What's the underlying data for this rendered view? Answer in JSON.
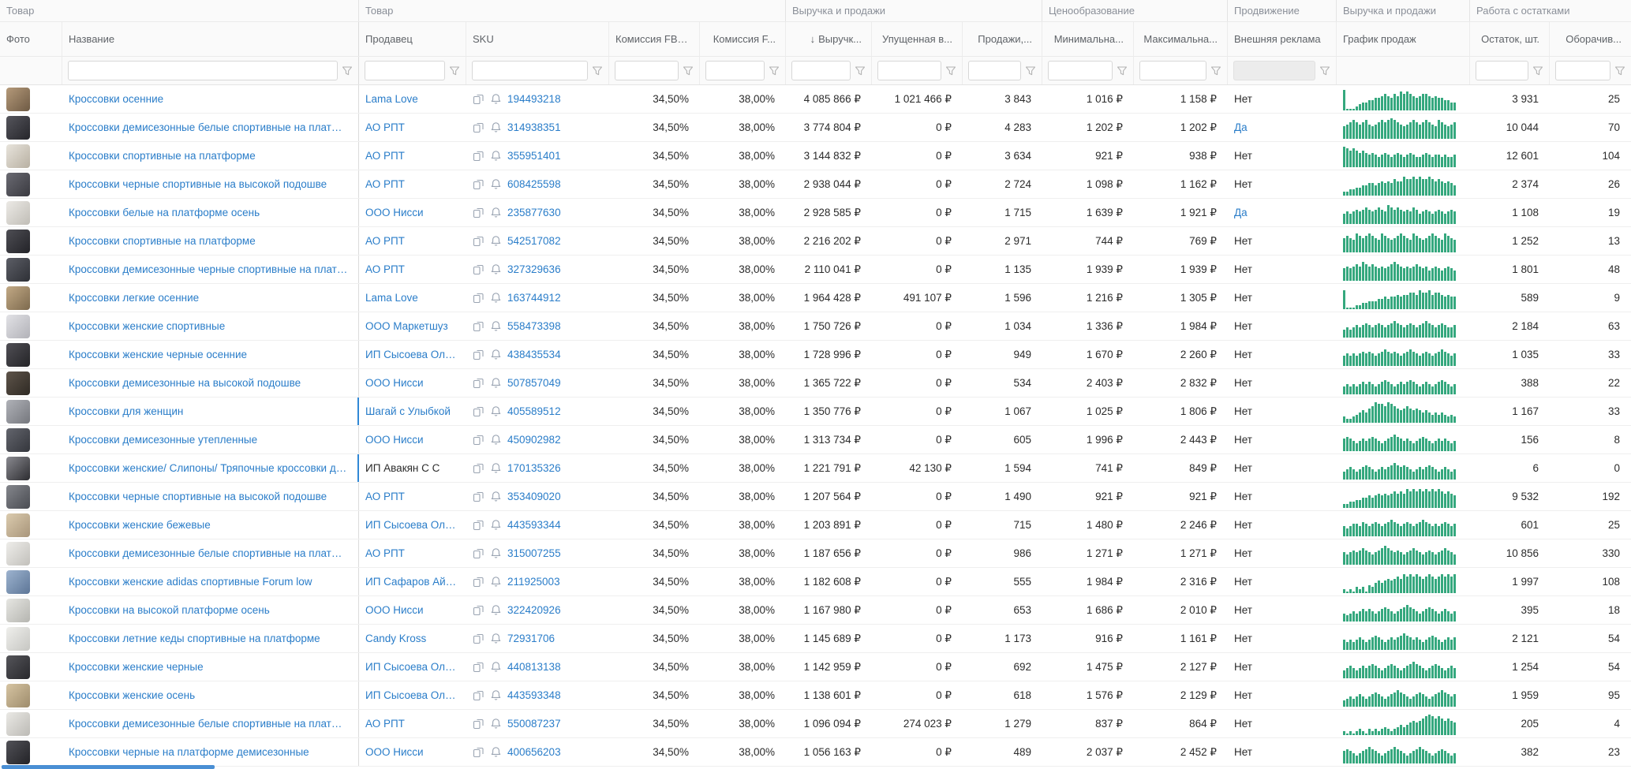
{
  "colors": {
    "link": "#2a7dc9",
    "spark_bar": "#35a87e",
    "scrollbar_thumb": "#4a8fd4",
    "header_bg": "#fafafa"
  },
  "icons": {
    "sort_desc": "↓"
  },
  "groups": [
    {
      "label": "Товар",
      "span": 2
    },
    {
      "label": "Товар",
      "span": 4
    },
    {
      "label": "Выручка и продажи",
      "span": 3
    },
    {
      "label": "Ценообразование",
      "span": 2
    },
    {
      "label": "Продвижение",
      "span": 1
    },
    {
      "label": "Выручка и продажи",
      "span": 1
    },
    {
      "label": "Работа с остатками",
      "span": 2
    }
  ],
  "columns": [
    {
      "name": "photo",
      "label": "Фото",
      "align": "left",
      "filter": false
    },
    {
      "name": "name",
      "label": "Название",
      "align": "left",
      "filter": true,
      "frozen": true
    },
    {
      "name": "seller",
      "label": "Продавец",
      "align": "left",
      "filter": true
    },
    {
      "name": "sku",
      "label": "SKU",
      "align": "left",
      "filter": true
    },
    {
      "name": "fbo-commission",
      "label": "Комиссия FBO, %",
      "align": "right",
      "filter": true
    },
    {
      "name": "fbs-commission",
      "label": "Комиссия F...",
      "align": "right",
      "filter": true
    },
    {
      "name": "revenue",
      "label": "Выручк...",
      "align": "right",
      "filter": true,
      "sorted": "desc"
    },
    {
      "name": "lost-revenue",
      "label": "Упущенная в...",
      "align": "right",
      "filter": true
    },
    {
      "name": "sales",
      "label": "Продажи,...",
      "align": "right",
      "filter": true
    },
    {
      "name": "min-price",
      "label": "Минимальна...",
      "align": "right",
      "filter": true
    },
    {
      "name": "max-price",
      "label": "Максимальна...",
      "align": "right",
      "filter": true
    },
    {
      "name": "external-ads",
      "label": "Внешняя реклама",
      "align": "left",
      "filter": true,
      "muted": true
    },
    {
      "name": "sales-chart",
      "label": "График продаж",
      "align": "left",
      "filter": false
    },
    {
      "name": "stock",
      "label": "Остаток, шт.",
      "align": "right",
      "filter": true
    },
    {
      "name": "turnover",
      "label": "Оборачив...",
      "align": "right",
      "filter": true
    }
  ],
  "rows": [
    {
      "name": "Кроссовки осенние",
      "seller": "Lama Love",
      "sku": "194493218",
      "fbo": "34,50%",
      "fbs": "38,00%",
      "revenue": "4 085 866 ₽",
      "lost": "1 021 466 ₽",
      "sales": "3 843",
      "min": "1 016 ₽",
      "max": "1 158 ₽",
      "ads": "Нет",
      "stock": "3 931",
      "turnover": "25",
      "photo": [
        "#b59a7a",
        "#6e5a44"
      ],
      "spark": "900012334455676576878765677656554433"
    },
    {
      "name": "Кроссовки демисезонные белые спортивные на платформе",
      "seller": "АО РПТ",
      "sku": "314938351",
      "fbo": "34,50%",
      "fbs": "38,00%",
      "revenue": "3 774 804 ₽",
      "lost": "0 ₽",
      "sales": "4 283",
      "min": "1 202 ₽",
      "max": "1 202 ₽",
      "ads": "Да",
      "stock": "10 044",
      "turnover": "70",
      "photo": [
        "#55555c",
        "#26262b"
      ],
      "spark": "567876786567878987656787678765876567"
    },
    {
      "name": "Кроссовки спортивные на платформе",
      "seller": "АО РПТ",
      "sku": "355951401",
      "fbo": "34,50%",
      "fbs": "38,00%",
      "revenue": "3 144 832 ₽",
      "lost": "0 ₽",
      "sales": "3 634",
      "min": "921 ₽",
      "max": "938 ₽",
      "ads": "Нет",
      "stock": "12 601",
      "turnover": "104",
      "photo": [
        "#e8e4dc",
        "#b8b0a2"
      ],
      "spark": "987876765654565456545654456545545445"
    },
    {
      "name": "Кроссовки черные спортивные на высокой подошве",
      "seller": "АО РПТ",
      "sku": "608425598",
      "fbo": "34,50%",
      "fbs": "38,00%",
      "revenue": "2 938 044 ₽",
      "lost": "0 ₽",
      "sales": "2 724",
      "min": "1 098 ₽",
      "max": "1 162 ₽",
      "ads": "Нет",
      "stock": "2 374",
      "turnover": "26",
      "photo": [
        "#6a6a72",
        "#3a3a40"
      ],
      "spark": "112233445545656576687787877876765654"
    },
    {
      "name": "Кроссовки белые на платформе осень",
      "seller": "ООО Нисси",
      "sku": "235877630",
      "fbo": "34,50%",
      "fbs": "38,00%",
      "revenue": "2 928 585 ₽",
      "lost": "0 ₽",
      "sales": "1 715",
      "min": "1 639 ₽",
      "max": "1 921 ₽",
      "ads": "Да",
      "stock": "1 108",
      "turnover": "19",
      "photo": [
        "#eceae6",
        "#c0bdb6"
      ],
      "spark": "454565676567658767656576456545654565"
    },
    {
      "name": "Кроссовки спортивные на платформе",
      "seller": "АО РПТ",
      "sku": "542517082",
      "fbo": "34,50%",
      "fbs": "38,00%",
      "revenue": "2 216 202 ₽",
      "lost": "0 ₽",
      "sales": "2 971",
      "min": "744 ₽",
      "max": "769 ₽",
      "ads": "Нет",
      "stock": "1 252",
      "turnover": "13",
      "photo": [
        "#4e4e54",
        "#232328"
      ],
      "spark": "676587678765876567876587656787658765"
    },
    {
      "name": "Кроссовки демисезонные черные спортивные на платфор...",
      "seller": "АО РПТ",
      "sku": "327329636",
      "fbo": "34,50%",
      "fbs": "38,00%",
      "revenue": "2 110 041 ₽",
      "lost": "0 ₽",
      "sales": "1 135",
      "min": "1 939 ₽",
      "max": "1 939 ₽",
      "ads": "Нет",
      "stock": "1 801",
      "turnover": "48",
      "photo": [
        "#5c5e66",
        "#2e3036"
      ],
      "spark": "565676876765656787656567656456545654"
    },
    {
      "name": "Кроссовки легкие осенние",
      "seller": "Lama Love",
      "sku": "163744912",
      "fbo": "34,50%",
      "fbs": "38,00%",
      "revenue": "1 964 428 ₽",
      "lost": "491 107 ₽",
      "sales": "1 596",
      "min": "1 216 ₽",
      "max": "1 305 ₽",
      "ads": "Нет",
      "stock": "589",
      "turnover": "9",
      "photo": [
        "#c2a985",
        "#7d6a4e"
      ],
      "spark": "800011223334454556566776877867765655"
    },
    {
      "name": "Кроссовки женские спортивные",
      "seller": "ООО Маркетшуз",
      "sku": "558473398",
      "fbo": "34,50%",
      "fbs": "38,00%",
      "revenue": "1 750 726 ₽",
      "lost": "0 ₽",
      "sales": "1 034",
      "min": "1 336 ₽",
      "max": "1 984 ₽",
      "ads": "Нет",
      "stock": "2 184",
      "turnover": "63",
      "photo": [
        "#e2e2e6",
        "#b2b2b8"
      ],
      "spark": "343454565456545676545654567654565445"
    },
    {
      "name": "Кроссовки женские черные осенние",
      "seller": "ИП Сысоева Ольга",
      "sku": "438435534",
      "fbo": "34,50%",
      "fbs": "38,00%",
      "revenue": "1 728 996 ₽",
      "lost": "0 ₽",
      "sales": "949",
      "min": "1 670 ₽",
      "max": "2 260 ₽",
      "ads": "Нет",
      "stock": "1 035",
      "turnover": "33",
      "photo": [
        "#504f55",
        "#242427"
      ],
      "spark": "454545656545676565456765456545676545"
    },
    {
      "name": "Кроссовки демисезонные на высокой подошве",
      "seller": "ООО Нисси",
      "sku": "507857049",
      "fbo": "34,50%",
      "fbs": "38,00%",
      "revenue": "1 365 722 ₽",
      "lost": "0 ₽",
      "sales": "534",
      "min": "2 403 ₽",
      "max": "2 832 ₽",
      "ads": "Нет",
      "stock": "388",
      "turnover": "22",
      "photo": [
        "#5e544a",
        "#2f2a24"
      ],
      "spark": "343434545434565434545654345434565434"
    },
    {
      "name": "Кроссовки для женщин",
      "seller": "Шагай с Улыбкой",
      "sku": "405589512",
      "fbo": "34,50%",
      "fbs": "38,00%",
      "revenue": "1 350 776 ₽",
      "lost": "0 ₽",
      "sales": "1 067",
      "min": "1 025 ₽",
      "max": "1 806 ₽",
      "ads": "Нет",
      "stock": "1 167",
      "turnover": "33",
      "photo": [
        "#b0b2b8",
        "#75777d"
      ],
      "spark": "211234546798879876567656545434343232",
      "accent": true
    },
    {
      "name": "Кроссовки демисезонные утепленные",
      "seller": "ООО Нисси",
      "sku": "450902982",
      "fbo": "34,50%",
      "fbs": "38,00%",
      "revenue": "1 313 734 ₽",
      "lost": "0 ₽",
      "sales": "605",
      "min": "1 996 ₽",
      "max": "2 443 ₽",
      "ads": "Нет",
      "stock": "156",
      "turnover": "8",
      "photo": [
        "#63656d",
        "#34363c"
      ],
      "spark": "565434545654345676545434565434545434"
    },
    {
      "name": "Кроссовки женские/ Слипоны/ Тряпочные кроссовки для с...",
      "seller": "ИП Авакян С С",
      "sku": "170135326",
      "fbo": "34,50%",
      "fbs": "38,00%",
      "revenue": "1 221 791 ₽",
      "lost": "42 130 ₽",
      "sales": "1 594",
      "min": "741 ₽",
      "max": "849 ₽",
      "ads": "Нет",
      "stock": "6",
      "turnover": "0",
      "photo": [
        "#8a8a90",
        "#2c2c30"
      ],
      "spark": "345434565434545676565434545654345434",
      "accent": true,
      "seller_dark": true
    },
    {
      "name": "Кроссовки черные спортивные на высокой подошве",
      "seller": "АО РПТ",
      "sku": "353409020",
      "fbo": "34,50%",
      "fbs": "38,00%",
      "revenue": "1 207 564 ₽",
      "lost": "0 ₽",
      "sales": "1 490",
      "min": "921 ₽",
      "max": "921 ₽",
      "ads": "Нет",
      "stock": "9 532",
      "turnover": "192",
      "photo": [
        "#84868c",
        "#4a4c52"
      ],
      "spark": "112233445456565676768787878787876765"
    },
    {
      "name": "Кроссовки женские бежевые",
      "seller": "ИП Сысоева Ольга",
      "sku": "443593344",
      "fbo": "34,50%",
      "fbs": "38,00%",
      "revenue": "1 203 891 ₽",
      "lost": "0 ₽",
      "sales": "715",
      "min": "1 480 ₽",
      "max": "2 246 ₽",
      "ads": "Нет",
      "stock": "601",
      "turnover": "25",
      "photo": [
        "#dbcbae",
        "#a8957a"
      ],
      "spark": "434554654565456765456545676545456545"
    },
    {
      "name": "Кроссовки демисезонные белые спортивные на платформе",
      "seller": "АО РПТ",
      "sku": "315007255",
      "fbo": "34,50%",
      "fbs": "38,00%",
      "revenue": "1 187 656 ₽",
      "lost": "0 ₽",
      "sales": "986",
      "min": "1 271 ₽",
      "max": "1 271 ₽",
      "ads": "Нет",
      "stock": "10 856",
      "turnover": "330",
      "photo": [
        "#eeedea",
        "#c2c0bb"
      ],
      "spark": "545656765456787656545676545654567654"
    },
    {
      "name": "Кроссовки женские adidas спортивные Forum low",
      "seller": "ИП Сафаров Айн...",
      "sku": "211925003",
      "fbo": "34,50%",
      "fbs": "38,00%",
      "revenue": "1 182 608 ₽",
      "lost": "0 ₽",
      "sales": "555",
      "min": "1 984 ₽",
      "max": "2 316 ₽",
      "ads": "Нет",
      "stock": "1 997",
      "turnover": "108",
      "photo": [
        "#9db3cf",
        "#5d7697"
      ],
      "spark": "101021203245456567687878767876787878"
    },
    {
      "name": "Кроссовки на высокой платформе осень",
      "seller": "ООО Нисси",
      "sku": "322420926",
      "fbo": "34,50%",
      "fbs": "38,00%",
      "revenue": "1 167 980 ₽",
      "lost": "0 ₽",
      "sales": "653",
      "min": "1 686 ₽",
      "max": "2 010 ₽",
      "ads": "Нет",
      "stock": "395",
      "turnover": "18",
      "photo": [
        "#e6e6e2",
        "#b5b5b0"
      ],
      "spark": "323434545434565434567654345654345434"
    },
    {
      "name": "Кроссовки летние кеды спортивные на платформе",
      "seller": "Candy Kross",
      "sku": "72931706",
      "fbo": "34,50%",
      "fbs": "38,00%",
      "revenue": "1 145 689 ₽",
      "lost": "0 ₽",
      "sales": "1 173",
      "min": "916 ₽",
      "max": "1 161 ₽",
      "ads": "Нет",
      "stock": "2 121",
      "turnover": "54",
      "photo": [
        "#efefec",
        "#c6c6c2"
      ],
      "spark": "434345434565434545676545434565434545"
    },
    {
      "name": "Кроссовки женские черные",
      "seller": "ИП Сысоева Ольга",
      "sku": "440813138",
      "fbo": "34,50%",
      "fbs": "38,00%",
      "revenue": "1 142 959 ₽",
      "lost": "0 ₽",
      "sales": "692",
      "min": "1 475 ₽",
      "max": "2 127 ₽",
      "ads": "Нет",
      "stock": "1 254",
      "turnover": "54",
      "photo": [
        "#55555a",
        "#28282c"
      ],
      "spark": "345434545654345654345676543456543454"
    },
    {
      "name": "Кроссовки женские осень",
      "seller": "ИП Сысоева Ольга",
      "sku": "443593348",
      "fbo": "34,50%",
      "fbs": "38,00%",
      "revenue": "1 138 601 ₽",
      "lost": "0 ₽",
      "sales": "618",
      "min": "1 576 ₽",
      "max": "2 129 ₽",
      "ads": "Нет",
      "stock": "1 959",
      "turnover": "95",
      "photo": [
        "#d6c4a2",
        "#9e8c6c"
      ],
      "spark": "234345434565434567654345654345676545"
    },
    {
      "name": "Кроссовки демисезонные белые спортивные на платформе",
      "seller": "АО РПТ",
      "sku": "550087237",
      "fbo": "34,50%",
      "fbs": "38,00%",
      "revenue": "1 096 094 ₽",
      "lost": "274 023 ₽",
      "sales": "1 279",
      "min": "837 ₽",
      "max": "864 ₽",
      "ads": "Нет",
      "stock": "205",
      "turnover": "4",
      "photo": [
        "#eae9e5",
        "#bcbab5"
      ],
      "spark": "101012102121232123434565678987876765"
    },
    {
      "name": "Кроссовки черные на платформе демисезонные",
      "seller": "ООО Нисси",
      "sku": "400656203",
      "fbo": "34,50%",
      "fbs": "38,00%",
      "revenue": "1 056 163 ₽",
      "lost": "0 ₽",
      "sales": "489",
      "min": "2 037 ₽",
      "max": "2 452 ₽",
      "ads": "Нет",
      "stock": "382",
      "turnover": "23",
      "photo": [
        "#515157",
        "#232327"
      ],
      "spark": "565434567654345676543456765434565434"
    }
  ]
}
